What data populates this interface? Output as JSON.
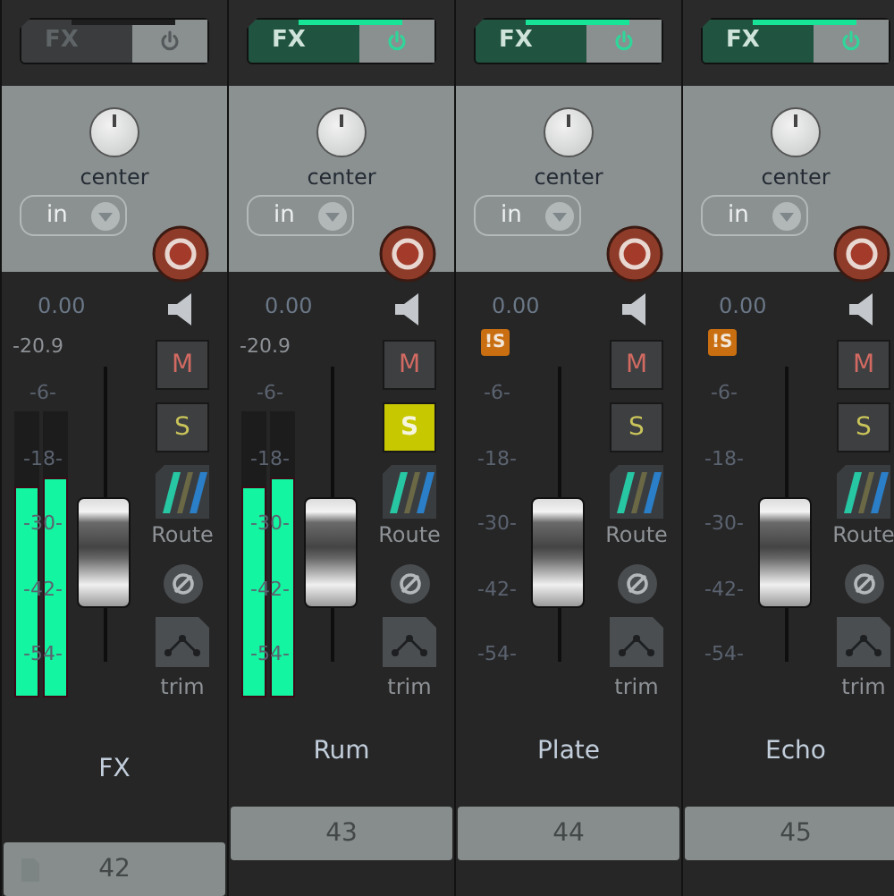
{
  "channels": [
    {
      "fx": {
        "label": "FX",
        "active": false
      },
      "pan": "center",
      "input": "in",
      "volume": "0.00",
      "peak": "-20.9",
      "scale": [
        "-6-",
        "-18-",
        "-30-",
        "-42-",
        "-54-"
      ],
      "meters": [
        {
          "level": 0.74
        },
        {
          "level": 0.77
        }
      ],
      "fader": {
        "level": 0.69
      },
      "mute": {
        "label": "M",
        "selected": false
      },
      "solo": {
        "label": "S",
        "selected": false
      },
      "route": "Route",
      "trim": "trim",
      "name": "FX",
      "folder": true,
      "number": "42"
    },
    {
      "fx": {
        "label": "FX",
        "active": true
      },
      "pan": "center",
      "input": "in",
      "volume": "0.00",
      "peak": "-20.9",
      "scale": [
        "-6-",
        "-18-",
        "-30-",
        "-42-",
        "-54-"
      ],
      "meters": [
        {
          "level": 0.74
        },
        {
          "level": 0.77
        }
      ],
      "fader": {
        "level": 0.69
      },
      "mute": {
        "label": "M",
        "selected": false
      },
      "solo": {
        "label": "S",
        "selected": true
      },
      "route": "Route",
      "trim": "trim",
      "name": "Rum",
      "folder": false,
      "number": "43"
    },
    {
      "fx": {
        "label": "FX",
        "active": true
      },
      "pan": "center",
      "input": "in",
      "volume": "0.00",
      "badge": "!S",
      "scale": [
        "-6-",
        "-18-",
        "-30-",
        "-42-",
        "-54-"
      ],
      "fader": {
        "level": 0.69
      },
      "mute": {
        "label": "M",
        "selected": false
      },
      "solo": {
        "label": "S",
        "selected": false
      },
      "route": "Route",
      "trim": "trim",
      "name": "Plate",
      "folder": false,
      "number": "44"
    },
    {
      "fx": {
        "label": "FX",
        "active": true
      },
      "pan": "center",
      "input": "in",
      "volume": "0.00",
      "badge": "!S",
      "scale": [
        "-6-",
        "-18-",
        "-30-",
        "-42-",
        "-54-"
      ],
      "fader": {
        "level": 0.69
      },
      "mute": {
        "label": "M",
        "selected": false
      },
      "solo": {
        "label": "S",
        "selected": false
      },
      "route": "Route",
      "trim": "trim",
      "name": "Echo",
      "folder": false,
      "number": "45"
    }
  ]
}
